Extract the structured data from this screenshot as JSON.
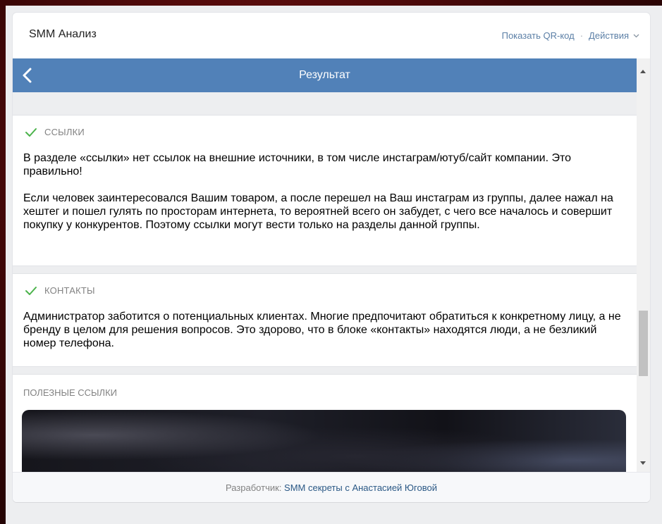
{
  "app": {
    "title": "SMM Анализ"
  },
  "top_actions": {
    "qr": "Показать QR-код",
    "separator": "·",
    "actions": "Действия"
  },
  "header": {
    "title": "Результат"
  },
  "sections": [
    {
      "title": "ССЫЛКИ",
      "paragraphs": [
        "В разделе «ссылки» нет ссылок на внешние источники, в том числе инстаграм/ютуб/сайт компании. Это правильно!",
        "Если человек заинтересовался Вашим товаром, а после перешел на Ваш инстаграм из группы, далее нажал на хештег и пошел гулять по просторам интернета, то вероятней всего он забудет, с чего все началось и совершит покупку у конкурентов. Поэтому ссылки могут вести только на разделы данной группы."
      ]
    },
    {
      "title": "КОНТАКТЫ",
      "paragraphs": [
        "Администратор заботится о потенциальных клиентах. Многие предпочитают обратиться к конкретному лицу, а не бренду в целом для решения вопросов. Это здорово, что в блоке «контакты» находятся люди, а не безликий номер телефона."
      ]
    }
  ],
  "useful": {
    "title": "ПОЛЕЗНЫЕ ССЫЛКИ"
  },
  "footer": {
    "prefix": "Разработчик: ",
    "link": "SMM секреты с Анастасией Юговой"
  },
  "icons": {
    "back": "chevron-left-icon",
    "check": "check-icon",
    "dropdown": "chevron-down-icon"
  },
  "colors": {
    "accent": "#5181b8",
    "check": "#4bb34b",
    "link": "#2a5885"
  },
  "scroll": {
    "position_fraction": 0.72
  }
}
